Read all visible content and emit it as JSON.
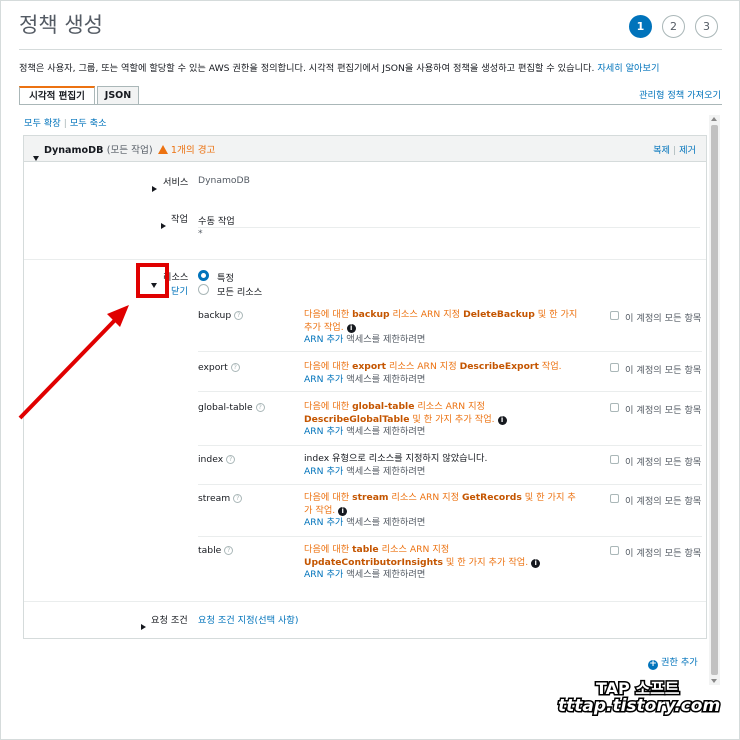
{
  "page": {
    "title": "정책 생성",
    "steps": [
      "1",
      "2",
      "3"
    ],
    "active_step": "1",
    "description": "정책은 사용자, 그룹, 또는 역할에 할당할 수 있는 AWS 권한을 정의합니다. 시각적 편집기에서 JSON을 사용하여 정책을 생성하고 편집할 수 있습니다.",
    "learn_more": "자세히 알아보기"
  },
  "tabs": [
    {
      "label": "시각적 편집기",
      "active": true
    },
    {
      "label": "JSON",
      "active": false
    }
  ],
  "import_policy": "관리형 정책 가져오기",
  "expand_all": "모두 확장",
  "collapse_all": "모두 축소",
  "service_block": {
    "header_service": "DynamoDB",
    "header_scope": "(모든 작업)",
    "warning": "1개의 경고",
    "clone": "복제",
    "remove": "제거",
    "service_label": "서비스",
    "service_value": "DynamoDB",
    "actions_label": "작업",
    "actions_value": "수동 작업",
    "actions_sub": "*",
    "resources_label": "리소스",
    "resources_close": "닫기",
    "radio_specific": "특정",
    "radio_all": "모든 리소스",
    "resources": [
      {
        "name": "backup",
        "prefix": "다음에 대한 ",
        "bold1": "backup",
        "mid": " 리소스 ARN 지정 ",
        "bold2": "DeleteBackup",
        "suffix": " 및 한 가지 추가 작업.",
        "plain": "",
        "info": true,
        "arn_link": "ARN 추가",
        "arn_rest": " 액세스를 제한하려면",
        "checkbox": "이 계정의 모든 항목"
      },
      {
        "name": "export",
        "prefix": "다음에 대한 ",
        "bold1": "export",
        "mid": " 리소스 ARN 지정 ",
        "bold2": "DescribeExport",
        "suffix": " 작업.",
        "plain": "",
        "info": false,
        "arn_link": "ARN 추가",
        "arn_rest": " 액세스를 제한하려면",
        "checkbox": "이 계정의 모든 항목"
      },
      {
        "name": "global-table",
        "prefix": "다음에 대한 ",
        "bold1": "global-table",
        "mid": " 리소스 ARN 지정 ",
        "bold2": "DescribeGlobalTable",
        "suffix": " 및 한 가지 추가 작업.",
        "plain": "",
        "info": true,
        "arn_link": "ARN 추가",
        "arn_rest": " 액세스를 제한하려면",
        "checkbox": "이 계정의 모든 항목"
      },
      {
        "name": "index",
        "prefix": "",
        "bold1": "",
        "mid": "",
        "bold2": "",
        "suffix": "",
        "plain": "index 유형으로 리소스를 지정하지 않았습니다.",
        "info": false,
        "arn_link": "ARN 추가",
        "arn_rest": " 액세스를 제한하려면",
        "checkbox": "이 계정의 모든 항목"
      },
      {
        "name": "stream",
        "prefix": "다음에 대한 ",
        "bold1": "stream",
        "mid": " 리소스 ARN 지정 ",
        "bold2": "GetRecords",
        "suffix": " 및 한 가지 추가 작업.",
        "plain": "",
        "info": true,
        "arn_link": "ARN 추가",
        "arn_rest": " 액세스를 제한하려면",
        "checkbox": "이 계정의 모든 항목"
      },
      {
        "name": "table",
        "prefix": "다음에 대한 ",
        "bold1": "table",
        "mid": " 리소스 ARN 지정 ",
        "bold2": "UpdateContributorInsights",
        "suffix": " 및 한 가지 추가 작업.",
        "plain": "",
        "info": true,
        "arn_link": "ARN 추가",
        "arn_rest": " 액세스를 제한하려면",
        "checkbox": "이 계정의 모든 항목"
      }
    ],
    "conditions_label": "요청 조건",
    "conditions_link": "요청 조건 지정(선택 사항)"
  },
  "add_permission": "권한 추가",
  "watermark": {
    "line1": "TAP 소프트",
    "line2": "tttap.tistory.com"
  },
  "colors": {
    "accent": "#0073bb",
    "warning": "#ec7211",
    "highlight": "#e00000"
  }
}
